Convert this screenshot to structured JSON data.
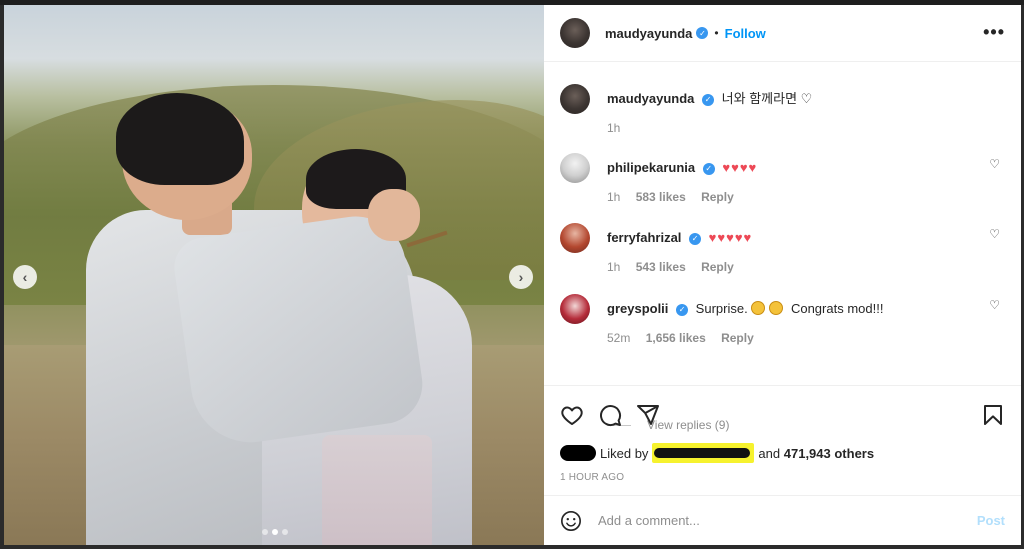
{
  "post": {
    "author": "maudyayunda",
    "follow_label": "Follow",
    "bullet": "•",
    "more_label": "•••"
  },
  "caption": {
    "username": "maudyayunda",
    "text": "너와 함께라면 ♡",
    "time": "1h"
  },
  "comments": [
    {
      "username": "philipekarunia",
      "text": "♥♥♥♥",
      "time": "1h",
      "likes": "583 likes",
      "reply": "Reply"
    },
    {
      "username": "ferryfahrizal",
      "text": "♥♥♥♥♥",
      "time": "1h",
      "likes": "543 likes",
      "reply": "Reply"
    },
    {
      "username": "greyspolii",
      "text_a": "Surprise.",
      "text_b": "Congrats mod!!!",
      "time": "52m",
      "likes": "1,656 likes",
      "reply": "Reply"
    }
  ],
  "view_replies": "View replies (9)",
  "likes": {
    "prefix": "Liked by",
    "suffix": "and",
    "others": "471,943 others"
  },
  "timestamp": "1 HOUR AGO",
  "comment_box": {
    "placeholder": "Add a comment...",
    "post_label": "Post"
  },
  "carousel": {
    "prev": "‹",
    "next": "›",
    "current_index": 2,
    "total": 3
  },
  "colors": {
    "link_blue": "#0095f6",
    "verified": "#3897f0",
    "heart_red": "#ed4956",
    "post_disabled": "#b2dffc"
  },
  "icons": [
    "heart-icon",
    "comment-icon",
    "share-icon",
    "bookmark-icon",
    "smiley-icon",
    "verified-icon",
    "more-icon",
    "chevron-left-icon",
    "chevron-right-icon"
  ]
}
